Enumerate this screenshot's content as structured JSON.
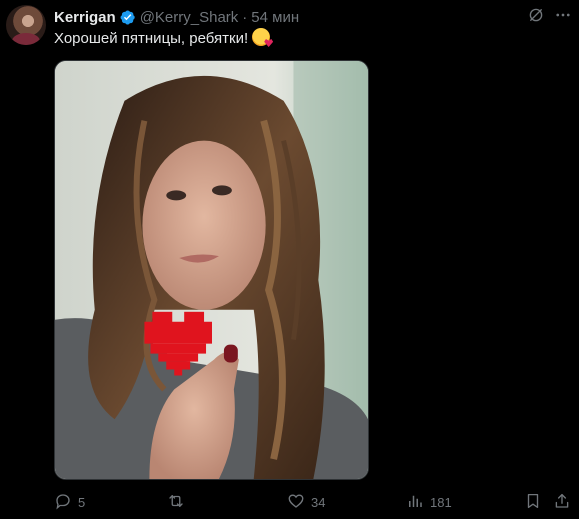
{
  "tweet": {
    "author_name": "Kerrigan",
    "handle": "@Kerry_Shark",
    "separator": "·",
    "time": "54 мин",
    "text": "Хорошей пятницы, ребятки!",
    "emoji": "smiling-face-with-hearts"
  },
  "actions": {
    "replies": "5",
    "retweets": "",
    "likes": "34",
    "views": "181"
  },
  "colors": {
    "background": "#000000",
    "text_primary": "#e7e9ea",
    "text_secondary": "#71767b",
    "verified": "#1d9bf0"
  },
  "icons": [
    "verified-badge-icon",
    "grok-icon",
    "more-icon",
    "reply-icon",
    "retweet-icon",
    "like-icon",
    "views-icon",
    "bookmark-icon",
    "share-icon"
  ]
}
